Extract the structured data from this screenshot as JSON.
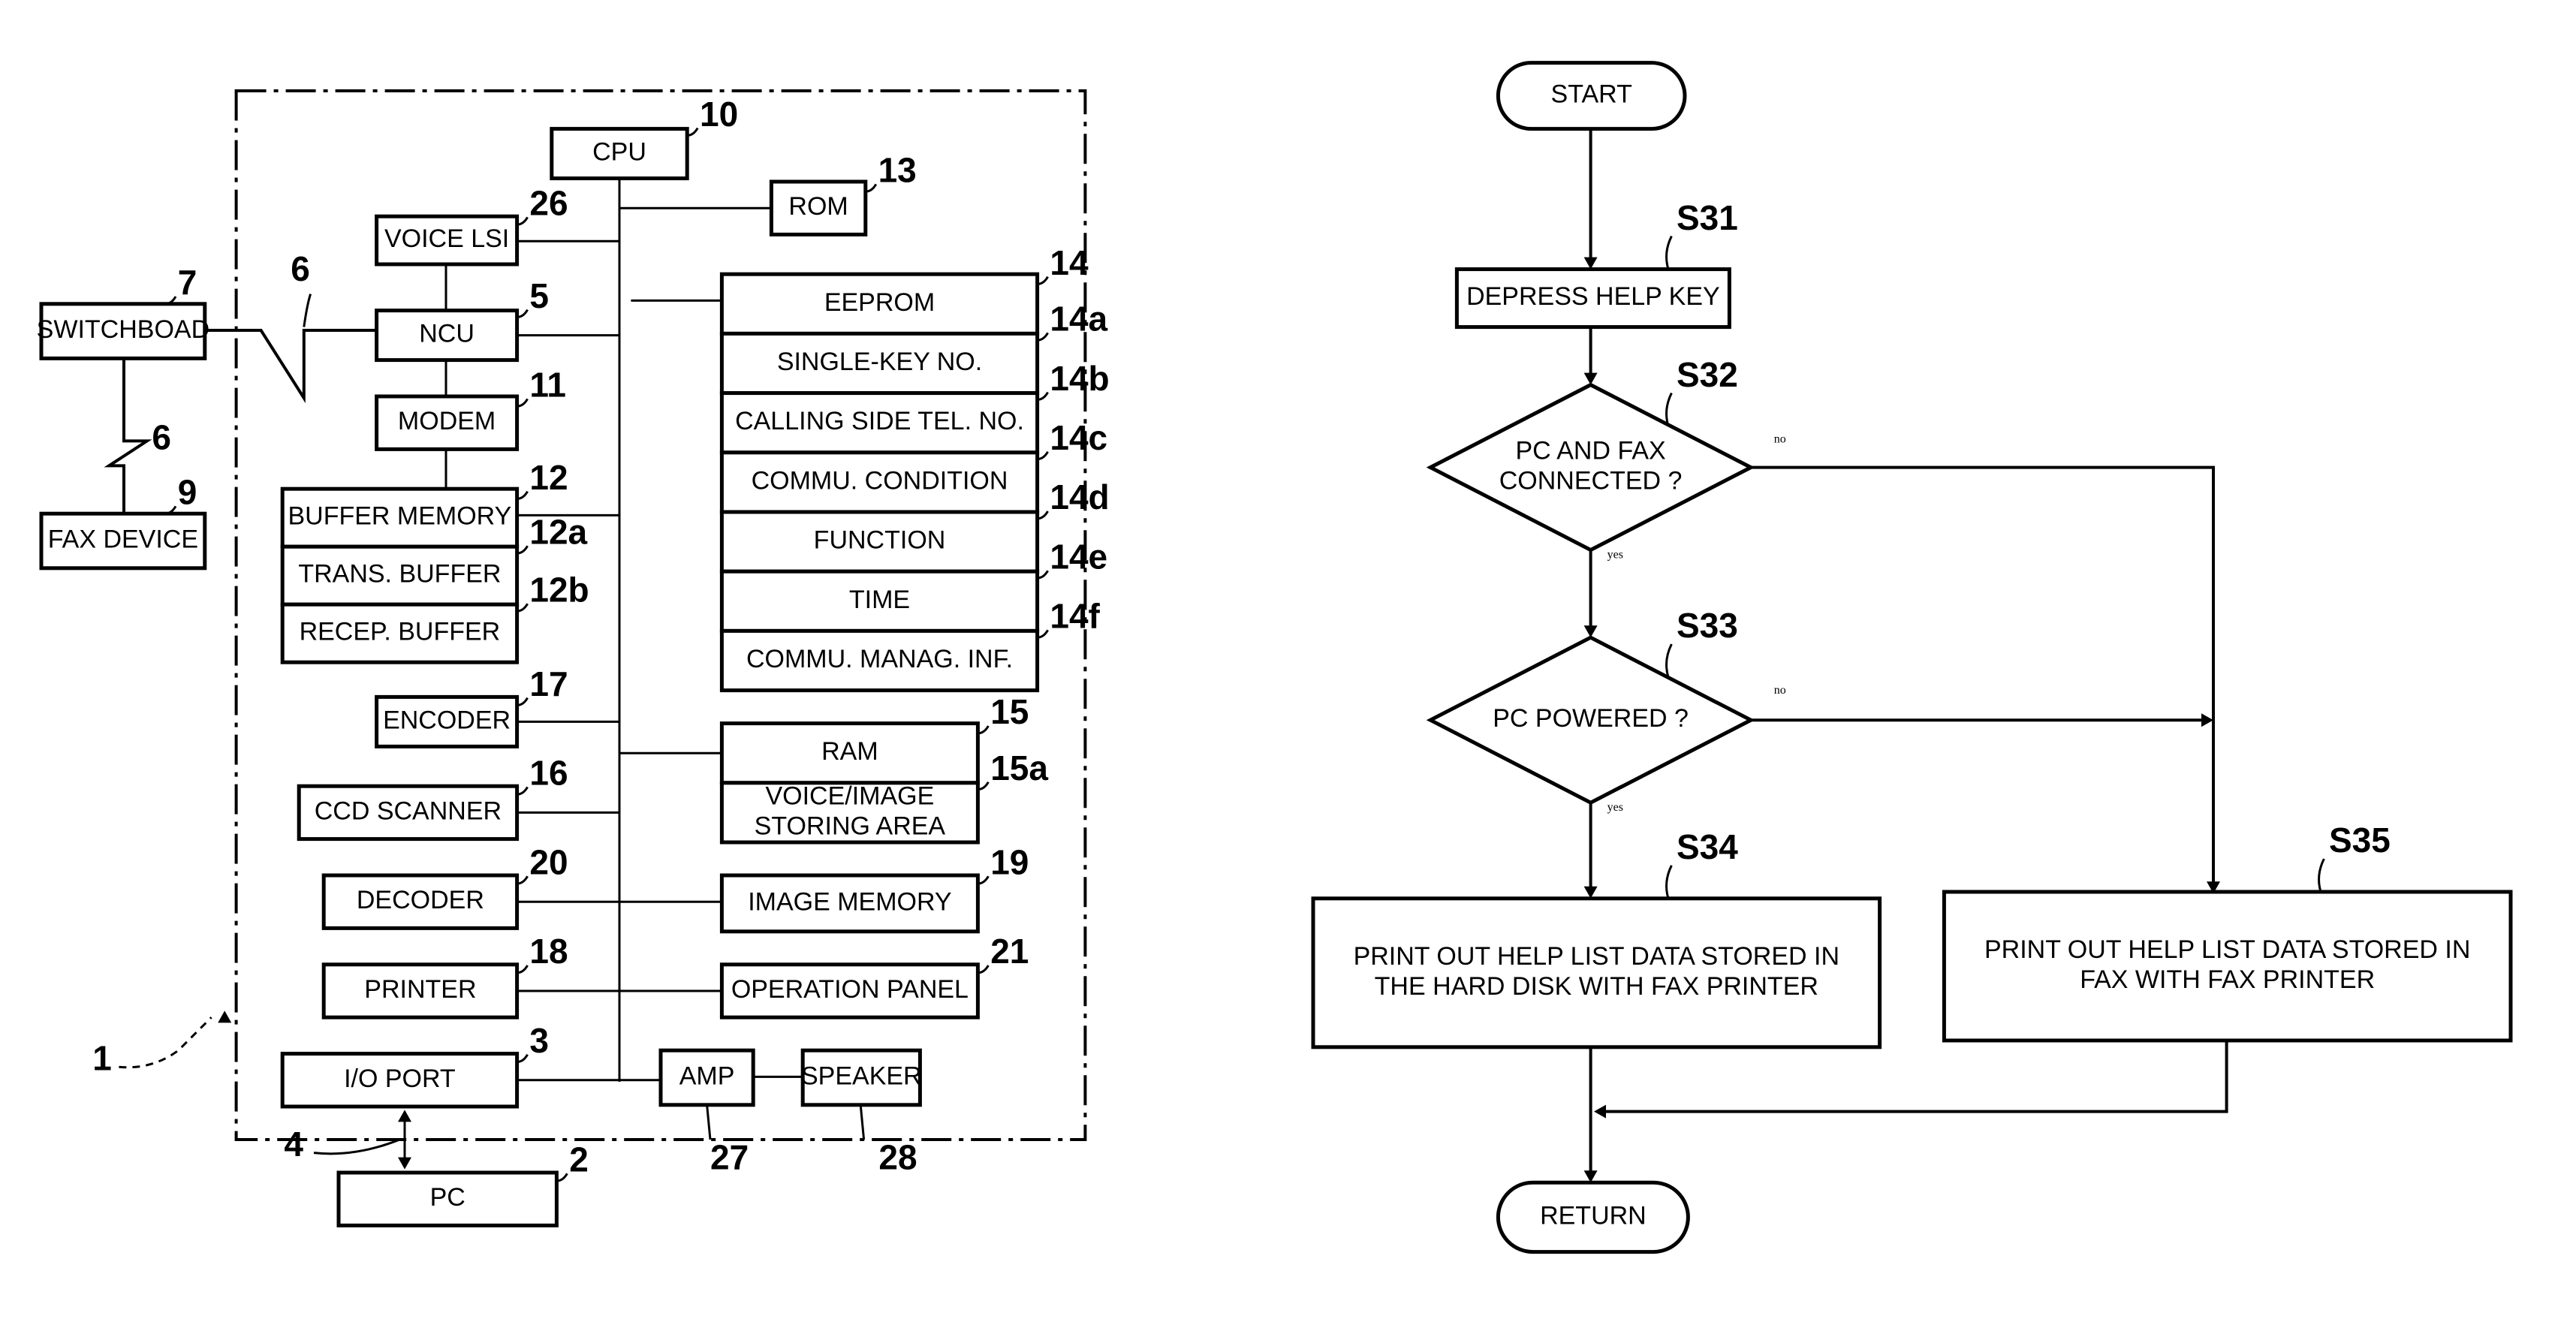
{
  "block_diagram": {
    "device_ref": "1",
    "cpu": {
      "label": "CPU",
      "ref": "10"
    },
    "rom": {
      "label": "ROM",
      "ref": "13"
    },
    "voice_lsi": {
      "label": "VOICE LSI",
      "ref": "26"
    },
    "ncu": {
      "label": "NCU",
      "ref": "5"
    },
    "modem": {
      "label": "MODEM",
      "ref": "11"
    },
    "buffer_memory": {
      "rows": [
        {
          "label": "BUFFER MEMORY",
          "ref": "12"
        },
        {
          "label": "TRANS. BUFFER",
          "ref": "12a"
        },
        {
          "label": "RECEP. BUFFER",
          "ref": "12b"
        }
      ]
    },
    "eeprom": {
      "rows": [
        {
          "label": "EEPROM",
          "ref": "14"
        },
        {
          "label": "SINGLE-KEY NO.",
          "ref": "14a"
        },
        {
          "label": "CALLING SIDE TEL. NO.",
          "ref": "14b"
        },
        {
          "label": "COMMU. CONDITION",
          "ref": "14c"
        },
        {
          "label": "FUNCTION",
          "ref": "14d"
        },
        {
          "label": "TIME",
          "ref": "14e"
        },
        {
          "label": "COMMU. MANAG. INF.",
          "ref": "14f"
        }
      ]
    },
    "encoder": {
      "label": "ENCODER",
      "ref": "17"
    },
    "ccd_scanner": {
      "label": "CCD SCANNER",
      "ref": "16"
    },
    "decoder": {
      "label": "DECODER",
      "ref": "20"
    },
    "printer": {
      "label": "PRINTER",
      "ref": "18"
    },
    "io_port": {
      "label": "I/O PORT",
      "ref": "3"
    },
    "ram": {
      "rows": [
        {
          "label": "RAM",
          "ref": "15"
        },
        {
          "label": "VOICE/IMAGE\nSTORING AREA",
          "ref": "15a"
        }
      ]
    },
    "image_memory": {
      "label": "IMAGE MEMORY",
      "ref": "19"
    },
    "operation_panel": {
      "label": "OPERATION PANEL",
      "ref": "21"
    },
    "amp": {
      "label": "AMP",
      "ref": "27"
    },
    "speaker": {
      "label": "SPEAKER",
      "ref": "28"
    },
    "pc": {
      "label": "PC",
      "ref": "2"
    },
    "pc_link_ref": "4",
    "switchboard": {
      "label": "SWITCHBOAD",
      "ref": "7"
    },
    "fax_device": {
      "label": "FAX DEVICE",
      "ref": "9"
    },
    "line_ref": "6"
  },
  "flowchart": {
    "start": "START",
    "s31": {
      "label": "DEPRESS HELP KEY",
      "ref": "S31"
    },
    "s32": {
      "label": "PC AND FAX\nCONNECTED ?",
      "ref": "S32"
    },
    "s33": {
      "label": "PC POWERED ?",
      "ref": "S33"
    },
    "s34": {
      "label": "PRINT OUT HELP LIST DATA STORED IN\nTHE HARD DISK WITH FAX PRINTER",
      "ref": "S34"
    },
    "s35": {
      "label": "PRINT OUT HELP LIST DATA STORED IN\nFAX WITH FAX PRINTER",
      "ref": "S35"
    },
    "yes_label": "yes",
    "no_label": "no",
    "end": "RETURN"
  }
}
